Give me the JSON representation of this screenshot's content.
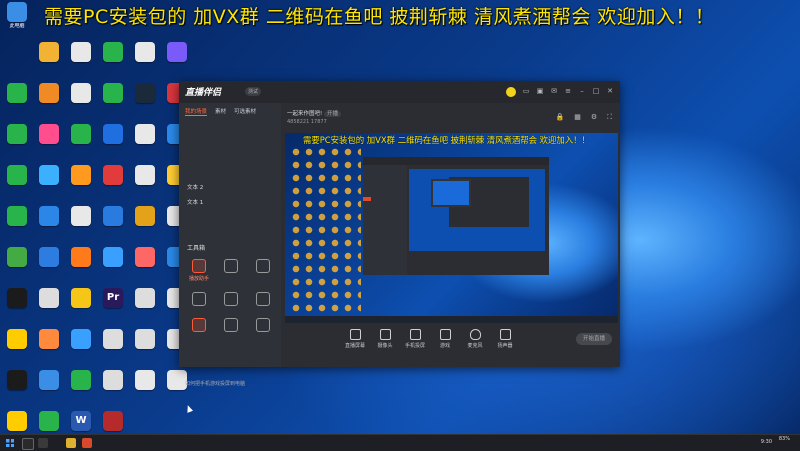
{
  "banner": {
    "text": "需要PC安装包的 加VX群 二维码在鱼吧 披荆斩棘 清风煮酒帮会 欢迎加入！！"
  },
  "desktop_icons": [
    {
      "label": "此电脑",
      "color": "#3a8ee6"
    },
    {
      "label": "",
      "color": "#f2b233"
    },
    {
      "label": "",
      "color": "#e8e8e8"
    },
    {
      "label": "",
      "color": "#29b34b"
    },
    {
      "label": "",
      "color": "#e8e8e8"
    },
    {
      "label": "",
      "color": "#7a5af8"
    },
    {
      "label": "",
      "color": "#29b34b"
    },
    {
      "label": "",
      "color": "#f08a24"
    },
    {
      "label": "",
      "color": "#e8e8e8"
    },
    {
      "label": "",
      "color": "#29b34b"
    },
    {
      "label": "",
      "color": "#1b2a3a"
    },
    {
      "label": "",
      "color": "#d9363e"
    },
    {
      "label": "",
      "color": "#29b34b"
    },
    {
      "label": "",
      "color": "#ff4d8d"
    },
    {
      "label": "",
      "color": "#29b34b"
    },
    {
      "label": "",
      "color": "#1f6fe0"
    },
    {
      "label": "",
      "color": "#e8e8e8"
    },
    {
      "label": "",
      "color": "#2a8ae8"
    },
    {
      "label": "",
      "color": "#29b34b"
    },
    {
      "label": "",
      "color": "#3ab0ff"
    },
    {
      "label": "",
      "color": "#ff9a1f"
    },
    {
      "label": "",
      "color": "#e23b3b"
    },
    {
      "label": "",
      "color": "#e8e8e8"
    },
    {
      "label": "",
      "color": "#ffcc33"
    },
    {
      "label": "",
      "color": "#29b34b"
    },
    {
      "label": "",
      "color": "#2c86e8"
    },
    {
      "label": "",
      "color": "#e8e8e8"
    },
    {
      "label": "",
      "color": "#2a7be0"
    },
    {
      "label": "",
      "color": "#e3a21a"
    },
    {
      "label": "",
      "color": "#e8e8e8"
    },
    {
      "label": "",
      "color": "#44aa44"
    },
    {
      "label": "",
      "color": "#2d7de0"
    },
    {
      "label": "",
      "color": "#ff7a1a"
    },
    {
      "label": "",
      "color": "#3aa0ff"
    },
    {
      "label": "",
      "color": "#ff6666"
    },
    {
      "label": "",
      "color": "#2a8ae8"
    },
    {
      "label": "",
      "color": "#1b1b1b"
    },
    {
      "label": "",
      "color": "#ddd"
    },
    {
      "label": "",
      "color": "#f5c518"
    },
    {
      "label": "Pr",
      "color": "#2a1a5c"
    },
    {
      "label": "",
      "color": "#ddd"
    },
    {
      "label": "",
      "color": "#e8e8e8"
    },
    {
      "label": "",
      "color": "#ffcc00"
    },
    {
      "label": "",
      "color": "#ff8a3d"
    },
    {
      "label": "",
      "color": "#3aa0ff"
    },
    {
      "label": "",
      "color": "#ddd"
    },
    {
      "label": "",
      "color": "#ddd"
    },
    {
      "label": "",
      "color": "#e8e8e8"
    },
    {
      "label": "",
      "color": "#1b1b1b"
    },
    {
      "label": "",
      "color": "#3a8ee6"
    },
    {
      "label": "",
      "color": "#29b34b"
    },
    {
      "label": "",
      "color": "#ddd"
    },
    {
      "label": "",
      "color": "#e8e8e8"
    },
    {
      "label": "",
      "color": "#e8e8e8"
    },
    {
      "label": "",
      "color": "#ffcc00"
    },
    {
      "label": "",
      "color": "#29b34b"
    },
    {
      "label": "W",
      "color": "#2a5ab0"
    },
    {
      "label": "",
      "color": "#b52a2a"
    }
  ],
  "app": {
    "brand": "直播伴侣",
    "brand_badge": "测试",
    "left_tabs": [
      "我的场景",
      "素材",
      "可选素材"
    ],
    "scenes": [
      "",
      "",
      "",
      "",
      "文本 2",
      "文本 1",
      ""
    ],
    "tools_title": "工具箱",
    "tools": [
      "播放助手",
      "",
      "",
      "",
      "",
      "",
      "",
      "",
      ""
    ],
    "help_text": "如何把手机游戏投屏到电脑",
    "room_title": "一起来作图吧!",
    "room_badge": "开播",
    "room_meta": "4858221  17877",
    "preview_banner": "需要PC安装包的 加VX群 二维码在鱼吧 披荆斩棘 清风煮酒帮会 欢迎加入！！",
    "controls": [
      "直播屏幕",
      "摄像头",
      "手机投屏",
      "游戏",
      "麦克风",
      "扬声器"
    ],
    "start_label": "开始直播",
    "status_text": "",
    "mini_badge": ""
  },
  "taskbar": {
    "time": "9:30",
    "tray_text": "83%"
  }
}
